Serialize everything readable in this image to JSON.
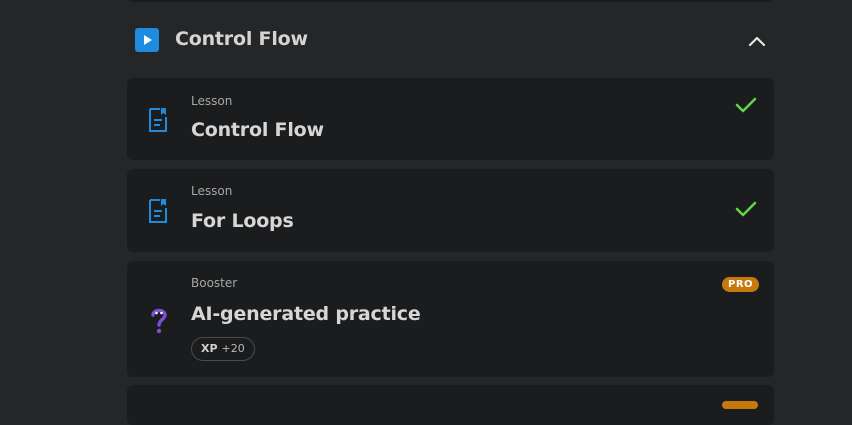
{
  "section": {
    "title": "Control Flow",
    "icon": "play-icon",
    "toggle_icon": "chevron-up-icon"
  },
  "items": [
    {
      "kind": "Lesson",
      "title": "Control Flow",
      "icon": "document-icon",
      "status": "completed"
    },
    {
      "kind": "Lesson",
      "title": "For Loops",
      "icon": "document-icon",
      "status": "completed"
    },
    {
      "kind": "Booster",
      "title": "AI-generated practice",
      "icon": "question-mark-icon",
      "badge": "PRO",
      "xp_label": "XP",
      "xp_value": "+20"
    }
  ],
  "colors": {
    "background": "#252627",
    "card": "#1b1c1d",
    "accent_blue": "#1c8be0",
    "check_green": "#61d345",
    "pro_orange": "#c8790e",
    "booster_purple": "#7b4fd8"
  }
}
